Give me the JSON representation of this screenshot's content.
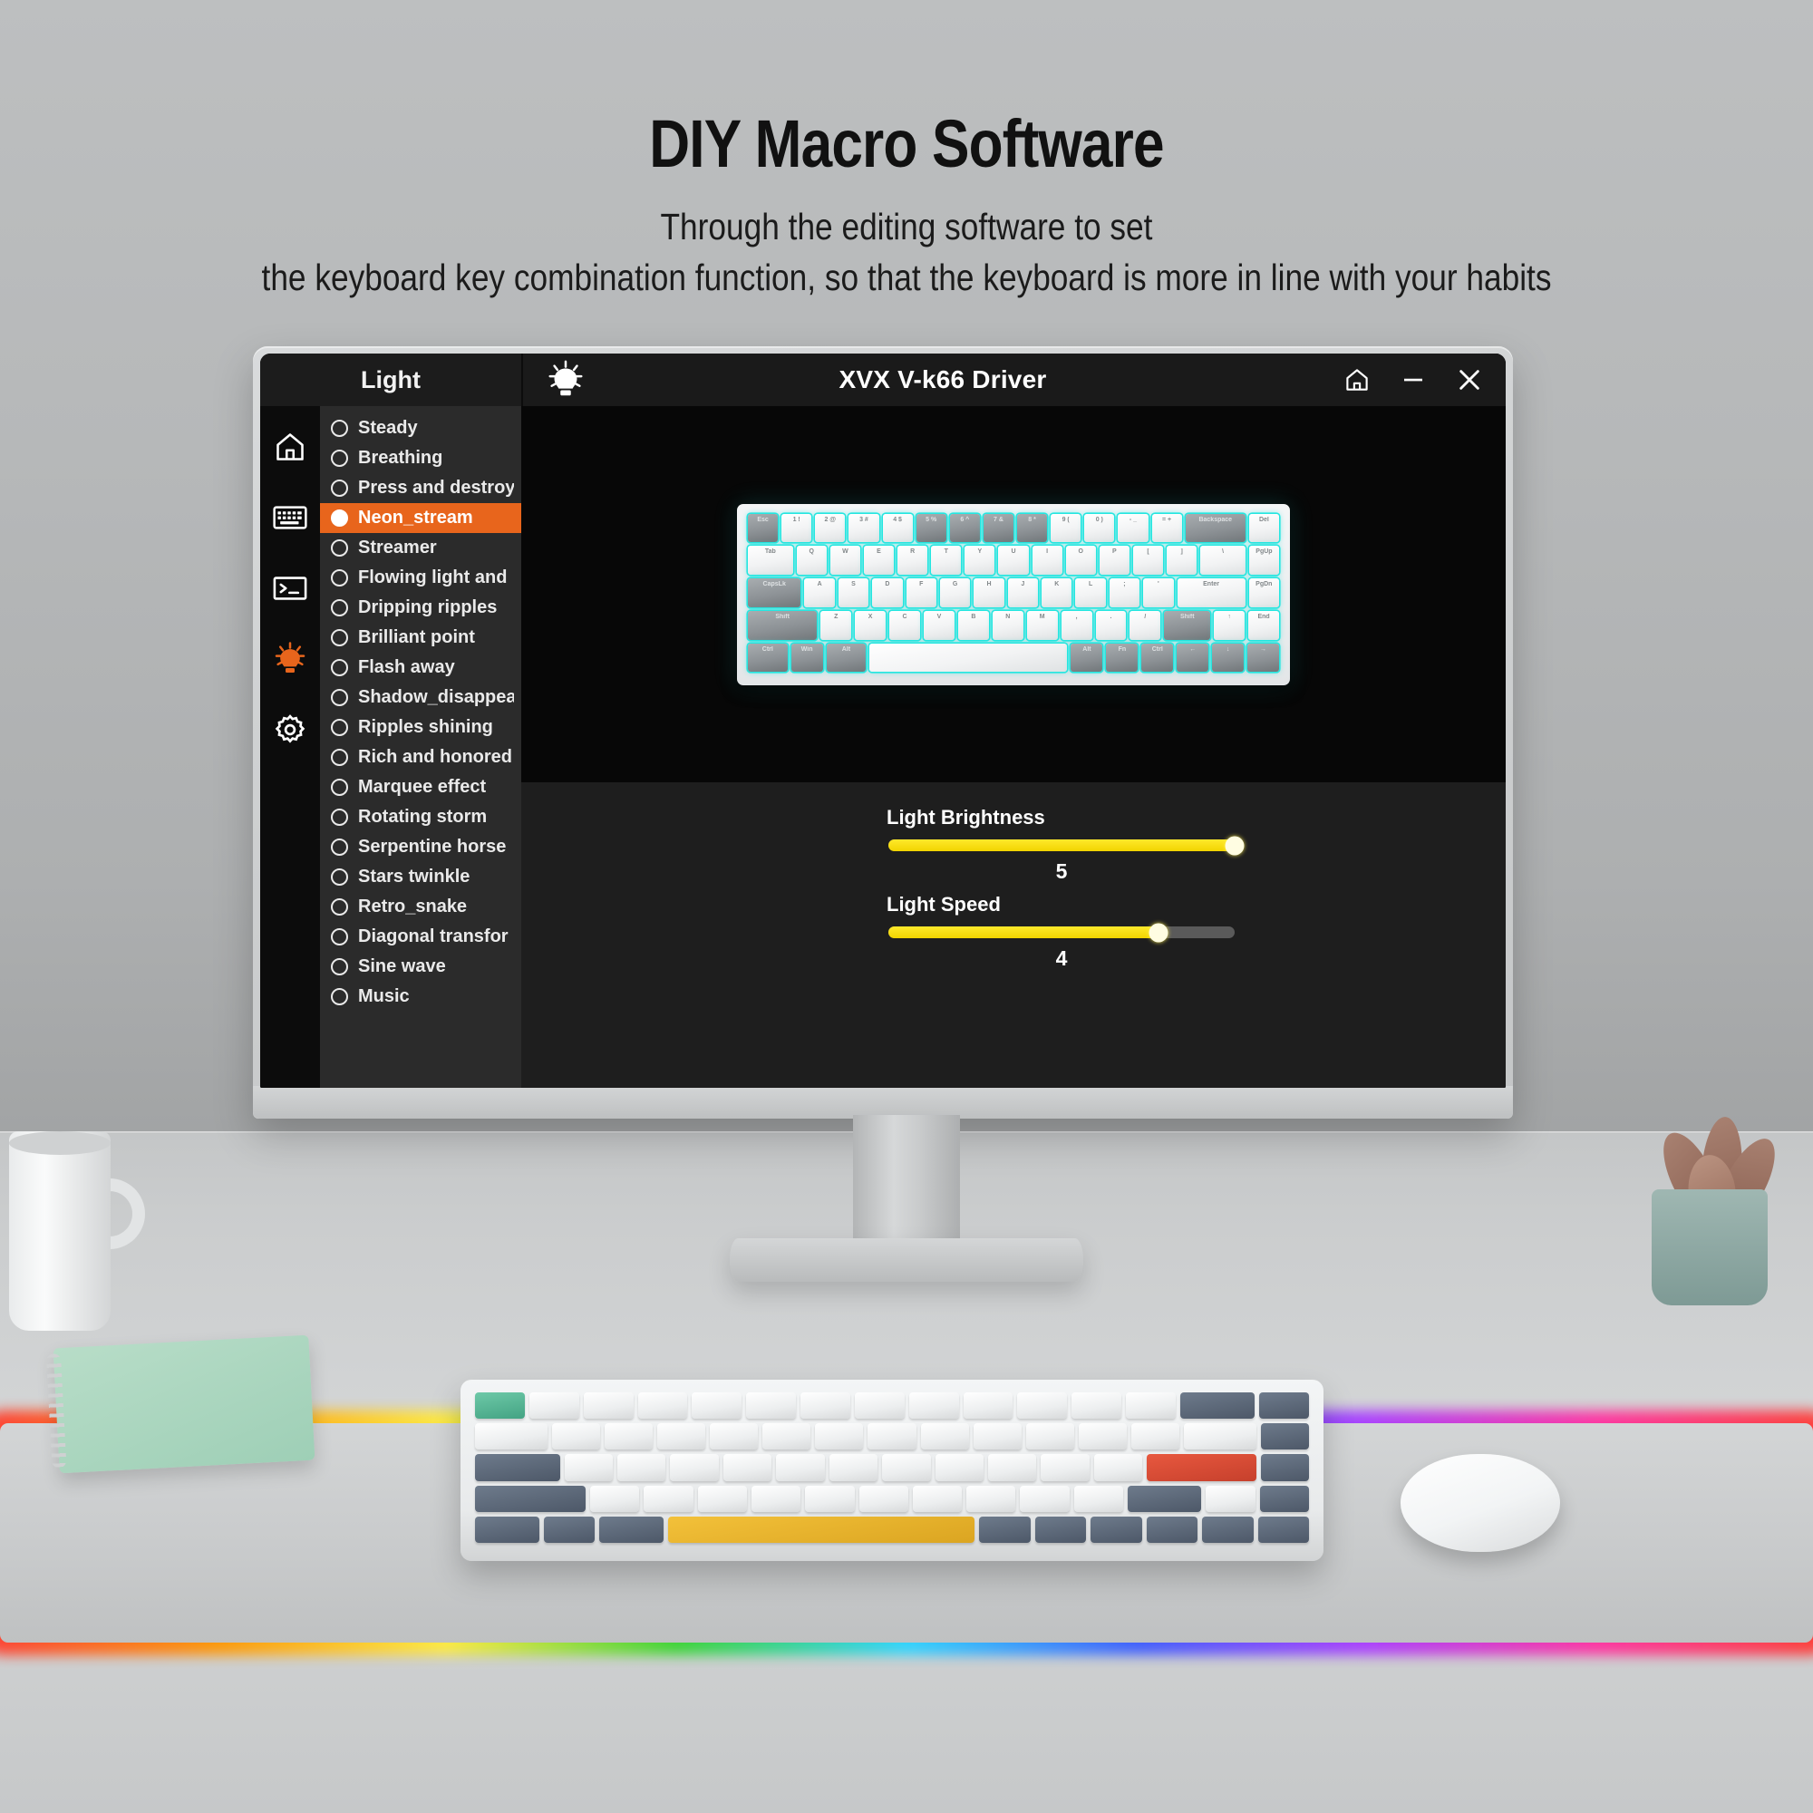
{
  "page": {
    "title": "DIY Macro Software",
    "subtitle_line1": "Through the editing software to set",
    "subtitle_line2": "the keyboard key combination function, so that the keyboard is more in line with your habits"
  },
  "app": {
    "panel_tab_label": "Light",
    "window_title": "XVX V-k66 Driver",
    "titlebar_icon": "lightbulb-icon",
    "window_buttons": [
      {
        "name": "home-button",
        "glyph": "home-icon"
      },
      {
        "name": "minimize-button",
        "glyph": "minimize-icon"
      },
      {
        "name": "close-button",
        "glyph": "close-icon"
      }
    ],
    "rail_items": [
      {
        "name": "rail-home",
        "icon": "home-icon",
        "active": false
      },
      {
        "name": "rail-keyboard",
        "icon": "keyboard-icon",
        "active": false
      },
      {
        "name": "rail-macro",
        "icon": "terminal-icon",
        "active": false
      },
      {
        "name": "rail-light",
        "icon": "lightbulb-icon",
        "active": true
      },
      {
        "name": "rail-settings",
        "icon": "gear-icon",
        "active": false
      }
    ],
    "accent_color": "#e8651c",
    "slider_color": "#f2d400",
    "modes": [
      {
        "label": "Steady",
        "selected": false
      },
      {
        "label": "Breathing",
        "selected": false
      },
      {
        "label": "Press and destroy",
        "selected": false
      },
      {
        "label": "Neon_stream",
        "selected": true
      },
      {
        "label": "Streamer",
        "selected": false
      },
      {
        "label": "Flowing light and",
        "selected": false
      },
      {
        "label": "Dripping ripples",
        "selected": false
      },
      {
        "label": "Brilliant point",
        "selected": false
      },
      {
        "label": "Flash away",
        "selected": false
      },
      {
        "label": "Shadow_disappea",
        "selected": false
      },
      {
        "label": "Ripples shining",
        "selected": false
      },
      {
        "label": "Rich and honored",
        "selected": false
      },
      {
        "label": "Marquee effect",
        "selected": false
      },
      {
        "label": "Rotating storm",
        "selected": false
      },
      {
        "label": "Serpentine horse",
        "selected": false
      },
      {
        "label": "Stars twinkle",
        "selected": false
      },
      {
        "label": "Retro_snake",
        "selected": false
      },
      {
        "label": "Diagonal transfor",
        "selected": false
      },
      {
        "label": "Sine wave",
        "selected": false
      },
      {
        "label": "Music",
        "selected": false
      }
    ],
    "controls": {
      "brightness": {
        "label": "Light Brightness",
        "value": "5",
        "percent": 100
      },
      "speed": {
        "label": "Light Speed",
        "value": "4",
        "percent": 78
      }
    },
    "preview": {
      "name": "keyboard-lighting-preview",
      "backlight_color": "#25e6e0",
      "rows": [
        [
          {
            "t": "Esc",
            "d": true
          },
          {
            "t": "1 !",
            "d": false
          },
          {
            "t": "2 @",
            "d": false
          },
          {
            "t": "3 #",
            "d": false
          },
          {
            "t": "4 $",
            "d": false
          },
          {
            "t": "5 %",
            "d": true
          },
          {
            "t": "6 ^",
            "d": true
          },
          {
            "t": "7 &",
            "d": true
          },
          {
            "t": "8 *",
            "d": true
          },
          {
            "t": "9 (",
            "d": false
          },
          {
            "t": "0 )",
            "d": false
          },
          {
            "t": "- _",
            "d": false
          },
          {
            "t": "= +",
            "d": false
          },
          {
            "t": "Backspace",
            "d": true,
            "w": "w2"
          },
          {
            "t": "Del",
            "d": false
          }
        ],
        [
          {
            "t": "Tab",
            "d": false,
            "w": "w15"
          },
          {
            "t": "Q",
            "d": false
          },
          {
            "t": "W",
            "d": false
          },
          {
            "t": "E",
            "d": false
          },
          {
            "t": "R",
            "d": false
          },
          {
            "t": "T",
            "d": false
          },
          {
            "t": "Y",
            "d": false
          },
          {
            "t": "U",
            "d": false
          },
          {
            "t": "I",
            "d": false
          },
          {
            "t": "O",
            "d": false
          },
          {
            "t": "P",
            "d": false
          },
          {
            "t": "[",
            "d": false
          },
          {
            "t": "]",
            "d": false
          },
          {
            "t": "\\",
            "d": false,
            "w": "w15"
          },
          {
            "t": "PgUp",
            "d": false
          }
        ],
        [
          {
            "t": "CapsLk",
            "d": true,
            "w": "w175"
          },
          {
            "t": "A",
            "d": false
          },
          {
            "t": "S",
            "d": false
          },
          {
            "t": "D",
            "d": false
          },
          {
            "t": "F",
            "d": false
          },
          {
            "t": "G",
            "d": false
          },
          {
            "t": "H",
            "d": false
          },
          {
            "t": "J",
            "d": false
          },
          {
            "t": "K",
            "d": false
          },
          {
            "t": "L",
            "d": false
          },
          {
            "t": ";",
            "d": false
          },
          {
            "t": "'",
            "d": false
          },
          {
            "t": "Enter",
            "d": false,
            "w": "w225"
          },
          {
            "t": "PgDn",
            "d": false
          }
        ],
        [
          {
            "t": "Shift",
            "d": true,
            "w": "w225"
          },
          {
            "t": "Z",
            "d": false
          },
          {
            "t": "X",
            "d": false
          },
          {
            "t": "C",
            "d": false
          },
          {
            "t": "V",
            "d": false
          },
          {
            "t": "B",
            "d": false
          },
          {
            "t": "N",
            "d": false
          },
          {
            "t": "M",
            "d": false
          },
          {
            "t": ",",
            "d": false
          },
          {
            "t": ".",
            "d": false
          },
          {
            "t": "/",
            "d": false
          },
          {
            "t": "Shift",
            "d": true,
            "w": "w15"
          },
          {
            "t": "↑",
            "d": false
          },
          {
            "t": "End",
            "d": false
          }
        ],
        [
          {
            "t": "Ctrl",
            "d": true,
            "w": "w125"
          },
          {
            "t": "Win",
            "d": true
          },
          {
            "t": "Alt",
            "d": true,
            "w": "w125"
          },
          {
            "t": "",
            "d": false,
            "w": "w625"
          },
          {
            "t": "Alt",
            "d": true
          },
          {
            "t": "Fn",
            "d": true
          },
          {
            "t": "Ctrl",
            "d": true
          },
          {
            "t": "←",
            "d": true
          },
          {
            "t": "↓",
            "d": true
          },
          {
            "t": "→",
            "d": true
          }
        ]
      ]
    }
  },
  "desk": {
    "keyboard": {
      "name": "physical-rgb-keyboard"
    },
    "mouse": {
      "name": "wireless-mouse"
    },
    "mousepad": {
      "name": "rgb-mousepad"
    },
    "cup": {
      "name": "ceramic-cup"
    },
    "notebook": {
      "name": "green-notebook"
    },
    "plant": {
      "name": "succulent-plant"
    }
  }
}
